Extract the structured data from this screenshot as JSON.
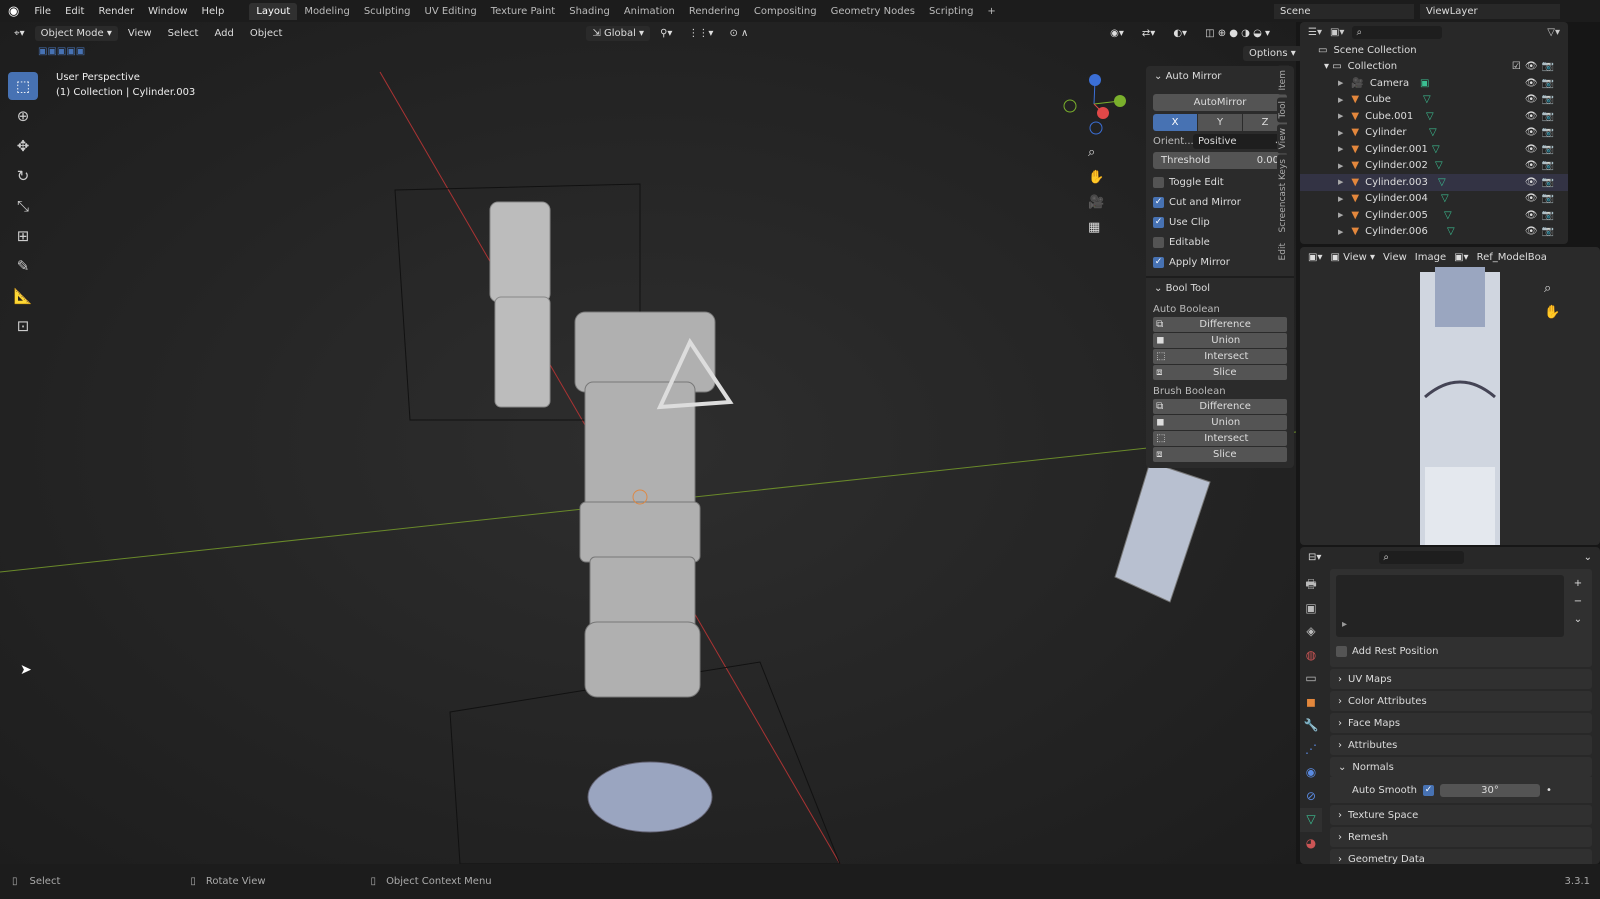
{
  "menubar": {
    "items": [
      "File",
      "Edit",
      "Render",
      "Window",
      "Help"
    ],
    "workspaces": [
      "Layout",
      "Modeling",
      "Sculpting",
      "UV Editing",
      "Texture Paint",
      "Shading",
      "Animation",
      "Rendering",
      "Compositing",
      "Geometry Nodes",
      "Scripting"
    ],
    "add_tab": "+",
    "scene": "Scene",
    "view_layer": "ViewLayer"
  },
  "viewport_header": {
    "mode": "Object Mode",
    "menus": [
      "View",
      "Select",
      "Add",
      "Object"
    ],
    "orientation": "Global",
    "options": "Options"
  },
  "viewport": {
    "perspective": "User Perspective",
    "context": "(1) Collection | Cylinder.003",
    "gizmo_axes": [
      "X",
      "Y",
      "Z"
    ]
  },
  "sidebar_tabs": [
    "Item",
    "Tool",
    "View",
    "Screencast Keys",
    "Edit"
  ],
  "auto_mirror": {
    "title": "Auto Mirror",
    "button": "AutoMirror",
    "axes": [
      "X",
      "Y",
      "Z"
    ],
    "active_axis": "X",
    "orient_label": "Orient...",
    "orient_value": "Positive",
    "threshold_label": "Threshold",
    "threshold_value": "0.00",
    "options": [
      {
        "label": "Toggle Edit",
        "checked": false
      },
      {
        "label": "Cut and Mirror",
        "checked": true
      },
      {
        "label": "Use Clip",
        "checked": true
      },
      {
        "label": "Editable",
        "checked": false
      },
      {
        "label": "Apply Mirror",
        "checked": true
      }
    ]
  },
  "bool_tool": {
    "title": "Bool Tool",
    "auto_label": "Auto Boolean",
    "brush_label": "Brush Boolean",
    "ops": [
      "Difference",
      "Union",
      "Intersect",
      "Slice"
    ]
  },
  "outliner": {
    "root": "Scene Collection",
    "collection": "Collection",
    "items": [
      "Camera",
      "Cube",
      "Cube.001",
      "Cylinder",
      "Cylinder.001",
      "Cylinder.002",
      "Cylinder.003",
      "Cylinder.004",
      "Cylinder.005",
      "Cylinder.006"
    ],
    "selected": "Cylinder.003"
  },
  "image_editor": {
    "menus": [
      "View",
      "View",
      "Image"
    ],
    "image_name": "Ref_ModelBoard"
  },
  "properties": {
    "add_rest_position": "Add Rest Position",
    "sections": [
      "UV Maps",
      "Color Attributes",
      "Face Maps",
      "Attributes",
      "Normals",
      "Texture Space",
      "Remesh",
      "Geometry Data"
    ],
    "auto_smooth_label": "Auto Smooth",
    "auto_smooth_angle": "30°"
  },
  "status": {
    "select": "Select",
    "rotate": "Rotate View",
    "context_menu": "Object Context Menu",
    "version": "3.3.1"
  },
  "colors": {
    "accent": "#4772b3",
    "mesh": "#3bbf92",
    "object": "#e3873c"
  }
}
